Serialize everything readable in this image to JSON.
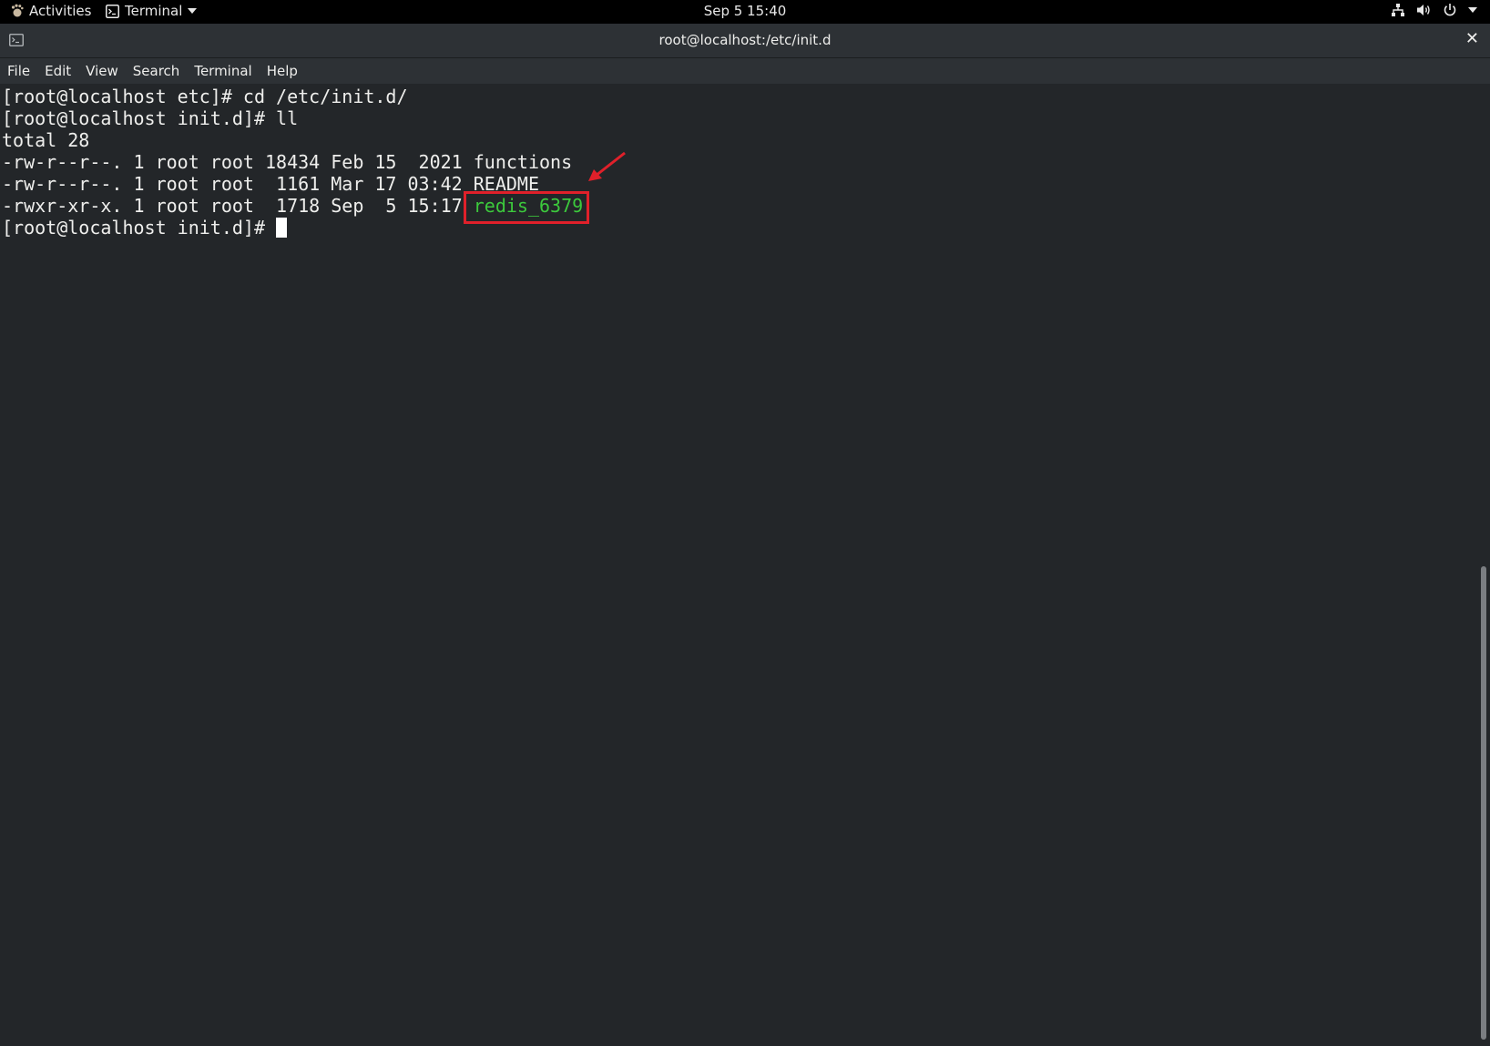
{
  "topbar": {
    "activities_label": "Activities",
    "app_label": "Terminal",
    "clock": "Sep 5  15:40",
    "icons": [
      "network-icon",
      "volume-icon",
      "power-icon",
      "chevron-down-icon"
    ]
  },
  "window": {
    "title": "root@localhost:/etc/init.d",
    "close_glyph": "✕"
  },
  "menubar": {
    "items": [
      "File",
      "Edit",
      "View",
      "Search",
      "Terminal",
      "Help"
    ]
  },
  "terminal": {
    "lines": [
      "[root@localhost etc]# cd /etc/init.d/",
      "[root@localhost init.d]# ll",
      "total 28",
      "-rw-r--r--. 1 root root 18434 Feb 15  2021 functions",
      "-rw-r--r--. 1 root root  1161 Mar 17 03:42 README",
      "-rwxr-xr-x. 1 root root  1718 Sep  5 15:17 "
    ],
    "highlighted_file": "redis_6379",
    "prompt": "[root@localhost init.d]# "
  },
  "colors": {
    "terminal_bg": "#232629",
    "executable_green": "#3cc93c",
    "annotation_red": "#e0202a"
  }
}
